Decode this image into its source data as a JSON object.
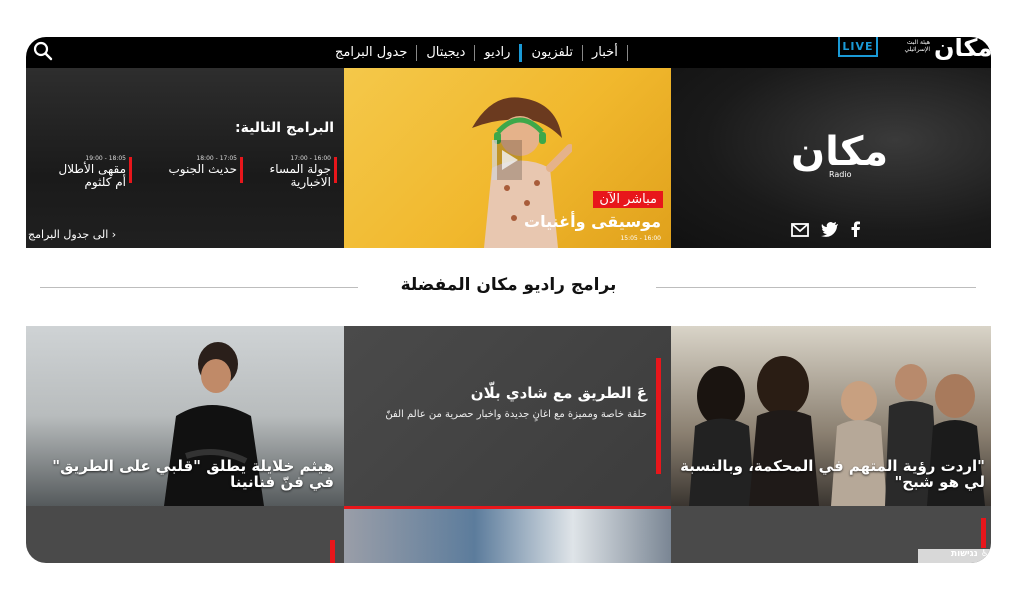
{
  "topbar": {
    "nav": [
      {
        "label": "جدول البرامج",
        "active": false
      },
      {
        "label": "ديجيتال",
        "active": false
      },
      {
        "label": "راديو",
        "active": true
      },
      {
        "label": "تلفزيون",
        "active": false
      },
      {
        "label": "أخبار",
        "active": false
      }
    ],
    "live_label": "LIVE",
    "brand_name": "مكان",
    "brand_sub": "هيئة البث الإسرائيلي"
  },
  "hero": {
    "next_title": "البرامج التالية:",
    "next": [
      {
        "time": "16:00 - 17:00",
        "name": "جولة المساء الاخبارية"
      },
      {
        "time": "17:05 - 18:00",
        "name": "حديث الجنوب"
      },
      {
        "time": "18:05 - 19:00",
        "name": "مقهى الأطلال أم كلثوم"
      }
    ],
    "to_schedule": "الى جدول البرامج",
    "live_now": "مباشر الآن",
    "current_program": "موسيقى وأغنيات",
    "current_time": "15:05 - 16:00",
    "radio_logo": "مكان",
    "radio_sub": "Radio"
  },
  "section": {
    "title": "برامج راديو مكان المفضلة"
  },
  "cards": {
    "left_title": "هيثم خلايلة يطلق \"قلبي على الطريق\" في فنّ فنانينا",
    "mid_title": "عَ الطريق مع شادي بلّان",
    "mid_desc": "حلقة خاصة ومميزة مع اغانٍ جديدة واخبار حصرية من عالم الفنّ",
    "right_title": "\"اردت رؤية المتهم في المحكمة، وبالنسبة لي هو شبح\""
  },
  "accessibility": {
    "label": "נגישות"
  },
  "colors": {
    "accent_red": "#e8161b",
    "accent_blue": "#1a9ad6"
  }
}
